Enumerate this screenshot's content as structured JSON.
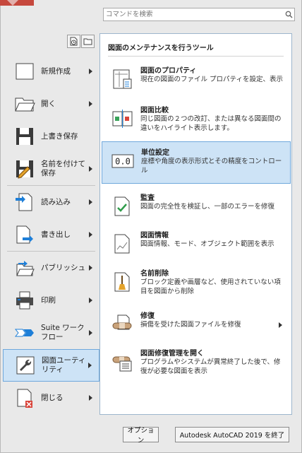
{
  "search": {
    "placeholder": "コマンドを検索"
  },
  "left_menu": [
    {
      "label": "新規作成",
      "icon": "new-document-icon",
      "has_arrow": true
    },
    {
      "label": "開く",
      "icon": "open-folder-icon",
      "has_arrow": true
    },
    {
      "label": "上書き保存",
      "icon": "save-icon",
      "has_arrow": false
    },
    {
      "label": "名前を付けて保存",
      "icon": "save-as-icon",
      "has_arrow": true
    },
    {
      "label": "読み込み",
      "icon": "import-icon",
      "has_arrow": true
    },
    {
      "label": "書き出し",
      "icon": "export-icon",
      "has_arrow": true
    },
    {
      "label": "パブリッシュ",
      "icon": "publish-icon",
      "has_arrow": true
    },
    {
      "label": "印刷",
      "icon": "print-icon",
      "has_arrow": true
    },
    {
      "label": "Suite ワークフロー",
      "icon": "suite-workflow-icon",
      "has_arrow": true
    },
    {
      "label": "図面ユーティリティ",
      "icon": "drawing-utilities-icon",
      "has_arrow": true,
      "active": true
    },
    {
      "label": "閉じる",
      "icon": "close-document-icon",
      "has_arrow": true
    }
  ],
  "panel": {
    "title": "図面のメンテナンスを行うツール",
    "items": [
      {
        "title": "図面のプロパティ",
        "desc": "現在の図面のファイル プロパティを設定、表示",
        "icon": "drawing-properties-icon"
      },
      {
        "title": "図面比較",
        "desc": "同じ図面の２つの改訂、または異なる図面間の違いをハイライト表示します。",
        "icon": "drawing-compare-icon"
      },
      {
        "title": "単位設定",
        "desc": "座標や角度の表示形式とその精度をコントロール",
        "icon": "units-icon",
        "icon_text": "0.0",
        "active": true
      },
      {
        "title": "監査",
        "desc": "図面の完全性を検証し、一部のエラーを修復",
        "icon": "audit-icon"
      },
      {
        "title": "図面情報",
        "desc": "図面情報、モード、オブジェクト範囲を表示",
        "icon": "drawing-status-icon"
      },
      {
        "title": "名前削除",
        "desc": "ブロック定義や画層など、使用されていない項目を図面から削除",
        "icon": "purge-icon"
      },
      {
        "title": "修復",
        "desc": "損傷を受けた図面ファイルを修復",
        "icon": "recover-icon",
        "has_arrow": true
      },
      {
        "title": "図面修復管理を開く",
        "desc": "プログラムやシステムが異常終了した後で、修復が必要な図面を表示",
        "icon": "drawing-recovery-manager-icon"
      }
    ]
  },
  "buttons": {
    "options": "オプション",
    "exit": "Autodesk AutoCAD 2019 を終了"
  },
  "colors": {
    "active_bg": "#cde3f6",
    "active_border": "#6fa8dc",
    "accent_blue": "#1e7fd8",
    "app_red": "#c6483d"
  }
}
